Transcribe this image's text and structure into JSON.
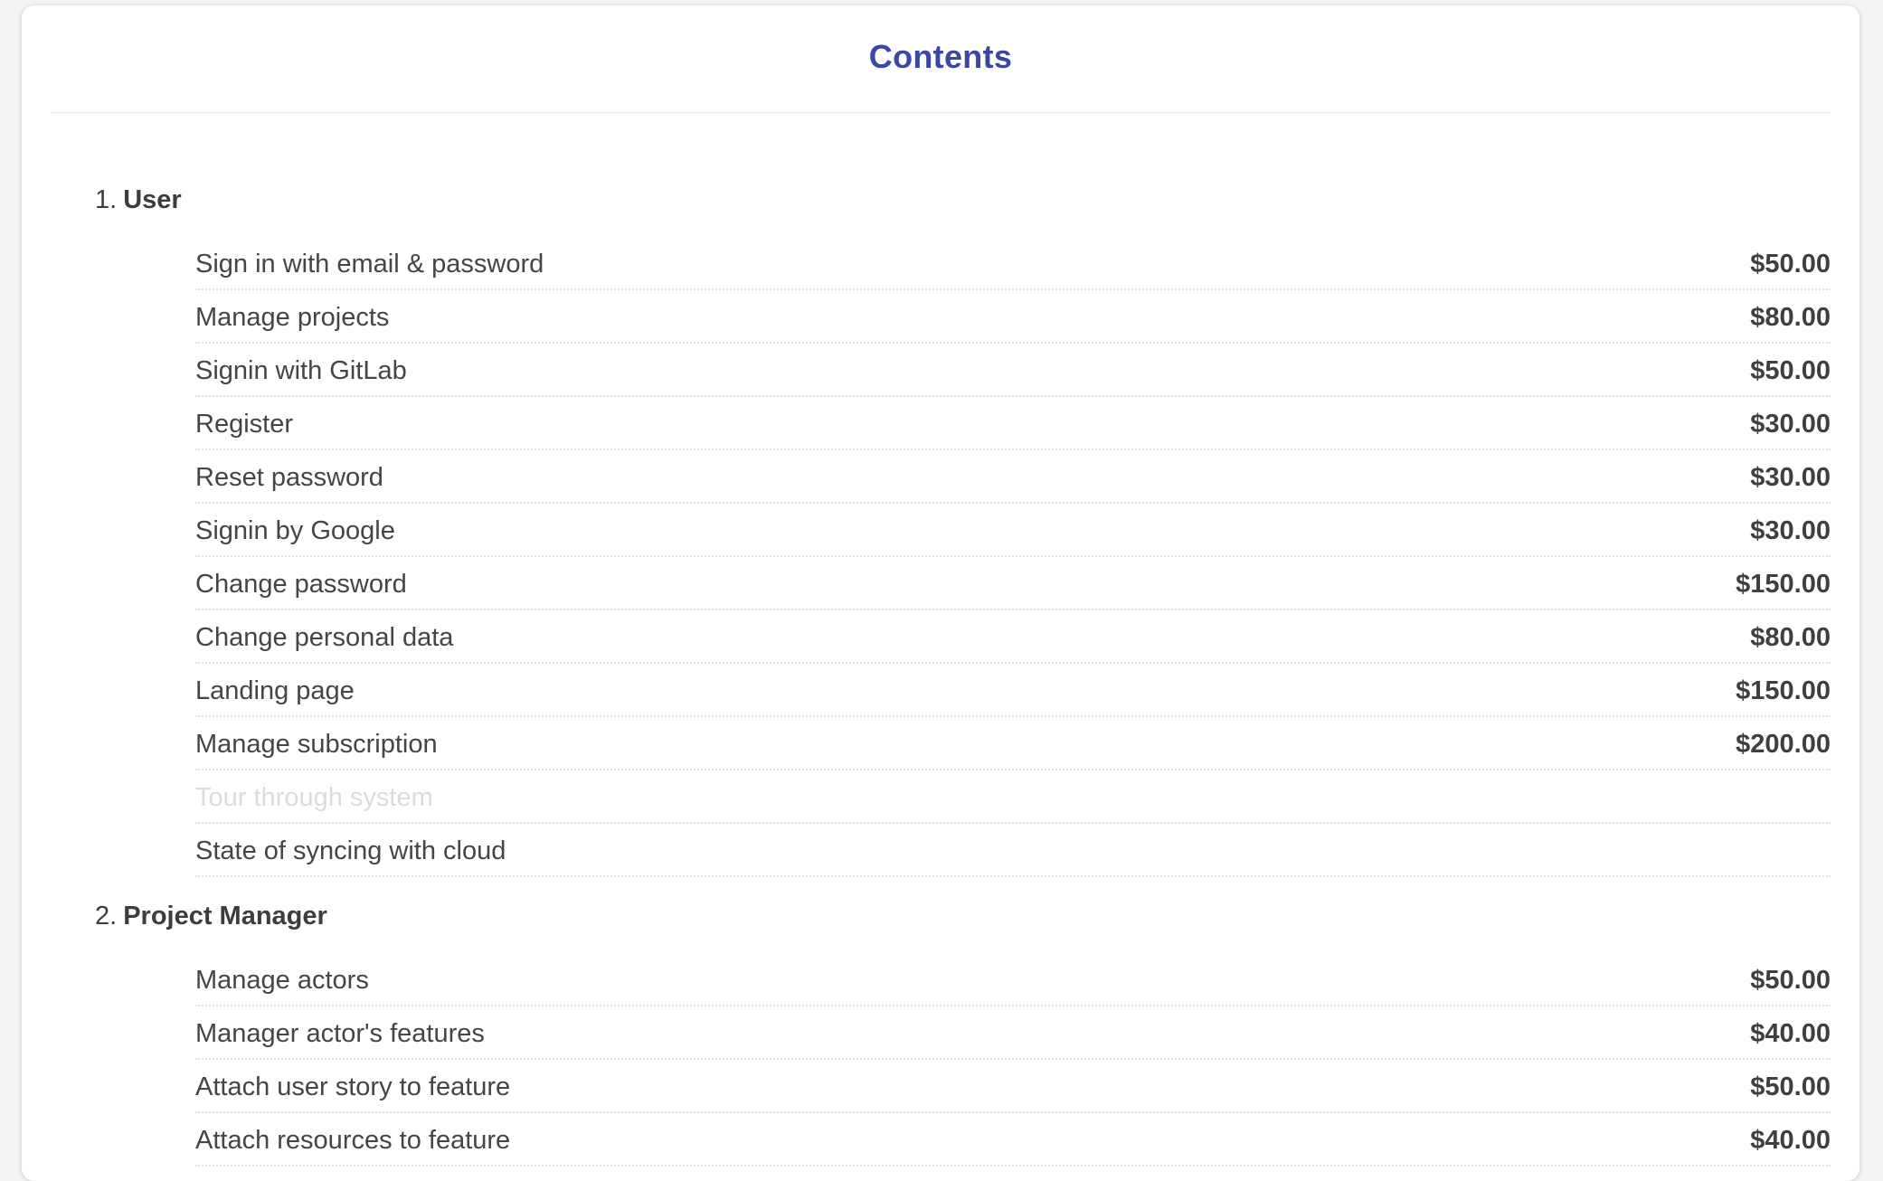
{
  "header": {
    "title": "Contents"
  },
  "sections": [
    {
      "number": "1.",
      "title": "User",
      "items": [
        {
          "name": "Sign in with email & password",
          "price": "$50.00"
        },
        {
          "name": "Manage projects",
          "price": "$80.00"
        },
        {
          "name": "Signin with GitLab",
          "price": "$50.00"
        },
        {
          "name": "Register",
          "price": "$30.00"
        },
        {
          "name": "Reset password",
          "price": "$30.00"
        },
        {
          "name": "Signin by Google",
          "price": "$30.00"
        },
        {
          "name": "Change password",
          "price": "$150.00"
        },
        {
          "name": "Change personal data",
          "price": "$80.00"
        },
        {
          "name": "Landing page",
          "price": "$150.00"
        },
        {
          "name": "Manage subscription",
          "price": "$200.00"
        },
        {
          "name": "Tour through system",
          "price": ""
        },
        {
          "name": "State of syncing with cloud",
          "price": ""
        }
      ]
    },
    {
      "number": "2.",
      "title": "Project Manager",
      "items": [
        {
          "name": "Manage actors",
          "price": "$50.00"
        },
        {
          "name": "Manager actor's features",
          "price": "$40.00"
        },
        {
          "name": "Attach user story to feature",
          "price": "$50.00"
        },
        {
          "name": "Attach resources to feature",
          "price": "$40.00"
        }
      ]
    }
  ]
}
